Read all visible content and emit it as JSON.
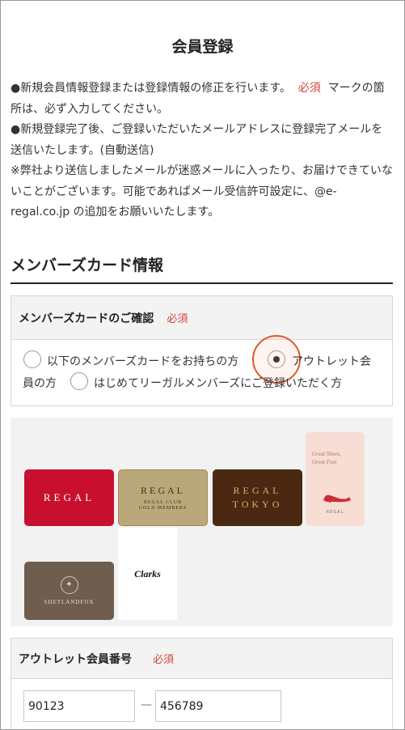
{
  "page": {
    "title": "会員登録"
  },
  "notes": {
    "line1_prefix": "●新規会員情報登録または登録情報の修正を行います。",
    "line1_required": "必須",
    "line1_suffix": "マークの箇所は、必ず入力してください。",
    "line2": "●新規登録完了後、ご登録いただいたメールアドレスに登録完了メールを送信いたします。(自動送信)",
    "line3": "※弊社より送信しましたメールが迷惑メールに入ったり、お届けできていないことがございます。可能であればメール受信許可設定に、@e-regal.co.jp の追加をお願いいたします。"
  },
  "section": {
    "heading": "メンバーズカード情報"
  },
  "card_confirm": {
    "label": "メンバーズカードのご確認",
    "required": "必須",
    "option1": "以下のメンバーズカードをお持ちの方",
    "option2_line1": "アウトレット会",
    "option2_line2": "員の方",
    "option3": "はじめてリーガルメンバーズにご登録いただく方",
    "selected": "option2"
  },
  "cards": {
    "regal": "REGAL",
    "gold_main": "REGAL",
    "gold_sub1": "REGAL CLUB",
    "gold_sub2": "GOLD MEMBERS",
    "tokyo_line1": "REGAL",
    "tokyo_line2": "TOKYO",
    "pink_script1": "Great Shoes,",
    "pink_script2": "Great Feet",
    "pink_brand": "REGAL",
    "shetland": "SHETLANDFOX",
    "clarks": "Clarks"
  },
  "outlet_number": {
    "label": "アウトレット会員番号",
    "required": "必須",
    "part1": "90123",
    "separator": "—",
    "part2": "456789"
  },
  "colors": {
    "required": "#d0453b",
    "highlight_ring": "#e05a30"
  }
}
